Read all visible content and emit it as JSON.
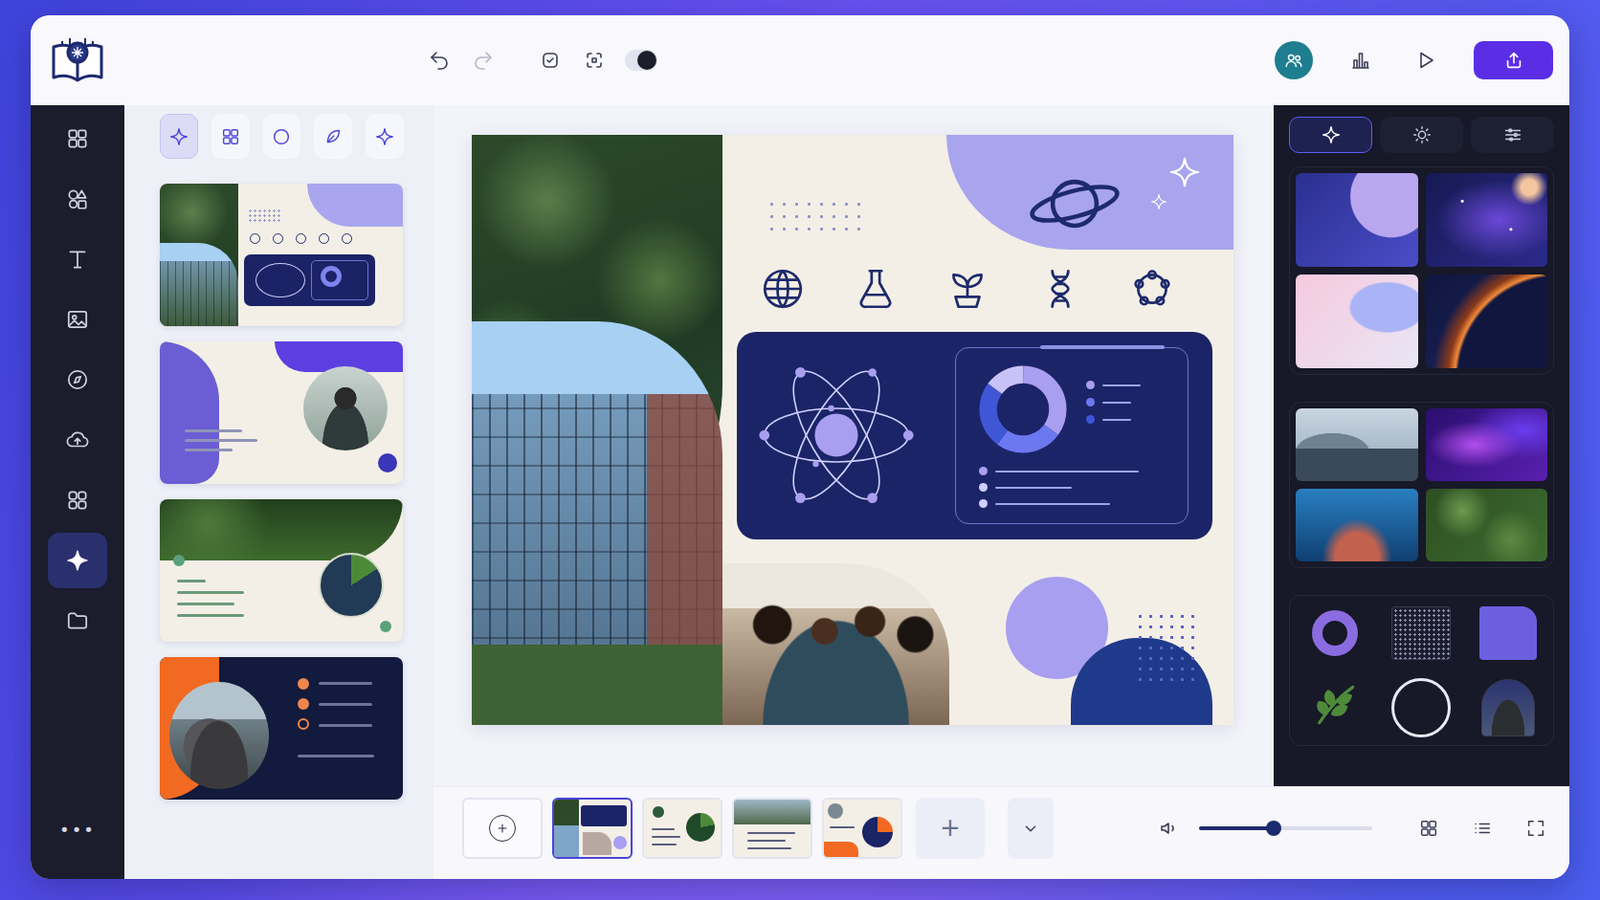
{
  "toolbar": {
    "dark_mode": {
      "on": true
    },
    "redo": {
      "disabled": true
    }
  },
  "sidebar": {
    "items": [
      {
        "selected": false
      },
      {
        "selected": false
      },
      {
        "selected": false
      },
      {
        "selected": false
      },
      {
        "selected": false
      },
      {
        "selected": false
      },
      {
        "selected": false
      },
      {
        "selected": true
      },
      {
        "selected": false
      }
    ],
    "more": "•••"
  },
  "templates": {
    "tabs": [
      {
        "selected": true
      },
      {
        "selected": false
      },
      {
        "selected": false
      },
      {
        "selected": false
      },
      {
        "selected": false
      }
    ],
    "cards": [
      {
        "kind": "science"
      },
      {
        "kind": "portrait"
      },
      {
        "kind": "forest"
      },
      {
        "kind": "night"
      }
    ]
  },
  "slide": {
    "donut": [
      {
        "value": 35,
        "color": "#a99ef0"
      },
      {
        "value": 25,
        "color": "#6c78f0"
      },
      {
        "value": 25,
        "color": "#3f57d6"
      },
      {
        "value": 15,
        "color": "#c8c2f7"
      }
    ]
  },
  "filmstrip": {
    "slides": [
      {
        "kind": "blank",
        "selected": false
      },
      {
        "kind": "science",
        "selected": true
      },
      {
        "kind": "forest",
        "selected": false
      },
      {
        "kind": "road",
        "selected": false
      },
      {
        "kind": "orange",
        "selected": false
      }
    ],
    "add": "+"
  },
  "design_panel": {
    "tabs": [
      {
        "selected": true
      },
      {
        "selected": false
      },
      {
        "selected": false
      }
    ],
    "backgrounds": [
      {
        "kind": "planet"
      },
      {
        "kind": "galaxy"
      },
      {
        "kind": "pastel"
      },
      {
        "kind": "eclipse"
      },
      {
        "kind": "mountains"
      },
      {
        "kind": "aurora"
      },
      {
        "kind": "reef"
      },
      {
        "kind": "leaves"
      }
    ],
    "shapes": [
      {
        "kind": "ring"
      },
      {
        "kind": "dots"
      },
      {
        "kind": "square"
      },
      {
        "kind": "leaf"
      },
      {
        "kind": "circle"
      },
      {
        "kind": "arch"
      }
    ]
  },
  "playback": {
    "volume": {
      "level": 0.43
    }
  }
}
